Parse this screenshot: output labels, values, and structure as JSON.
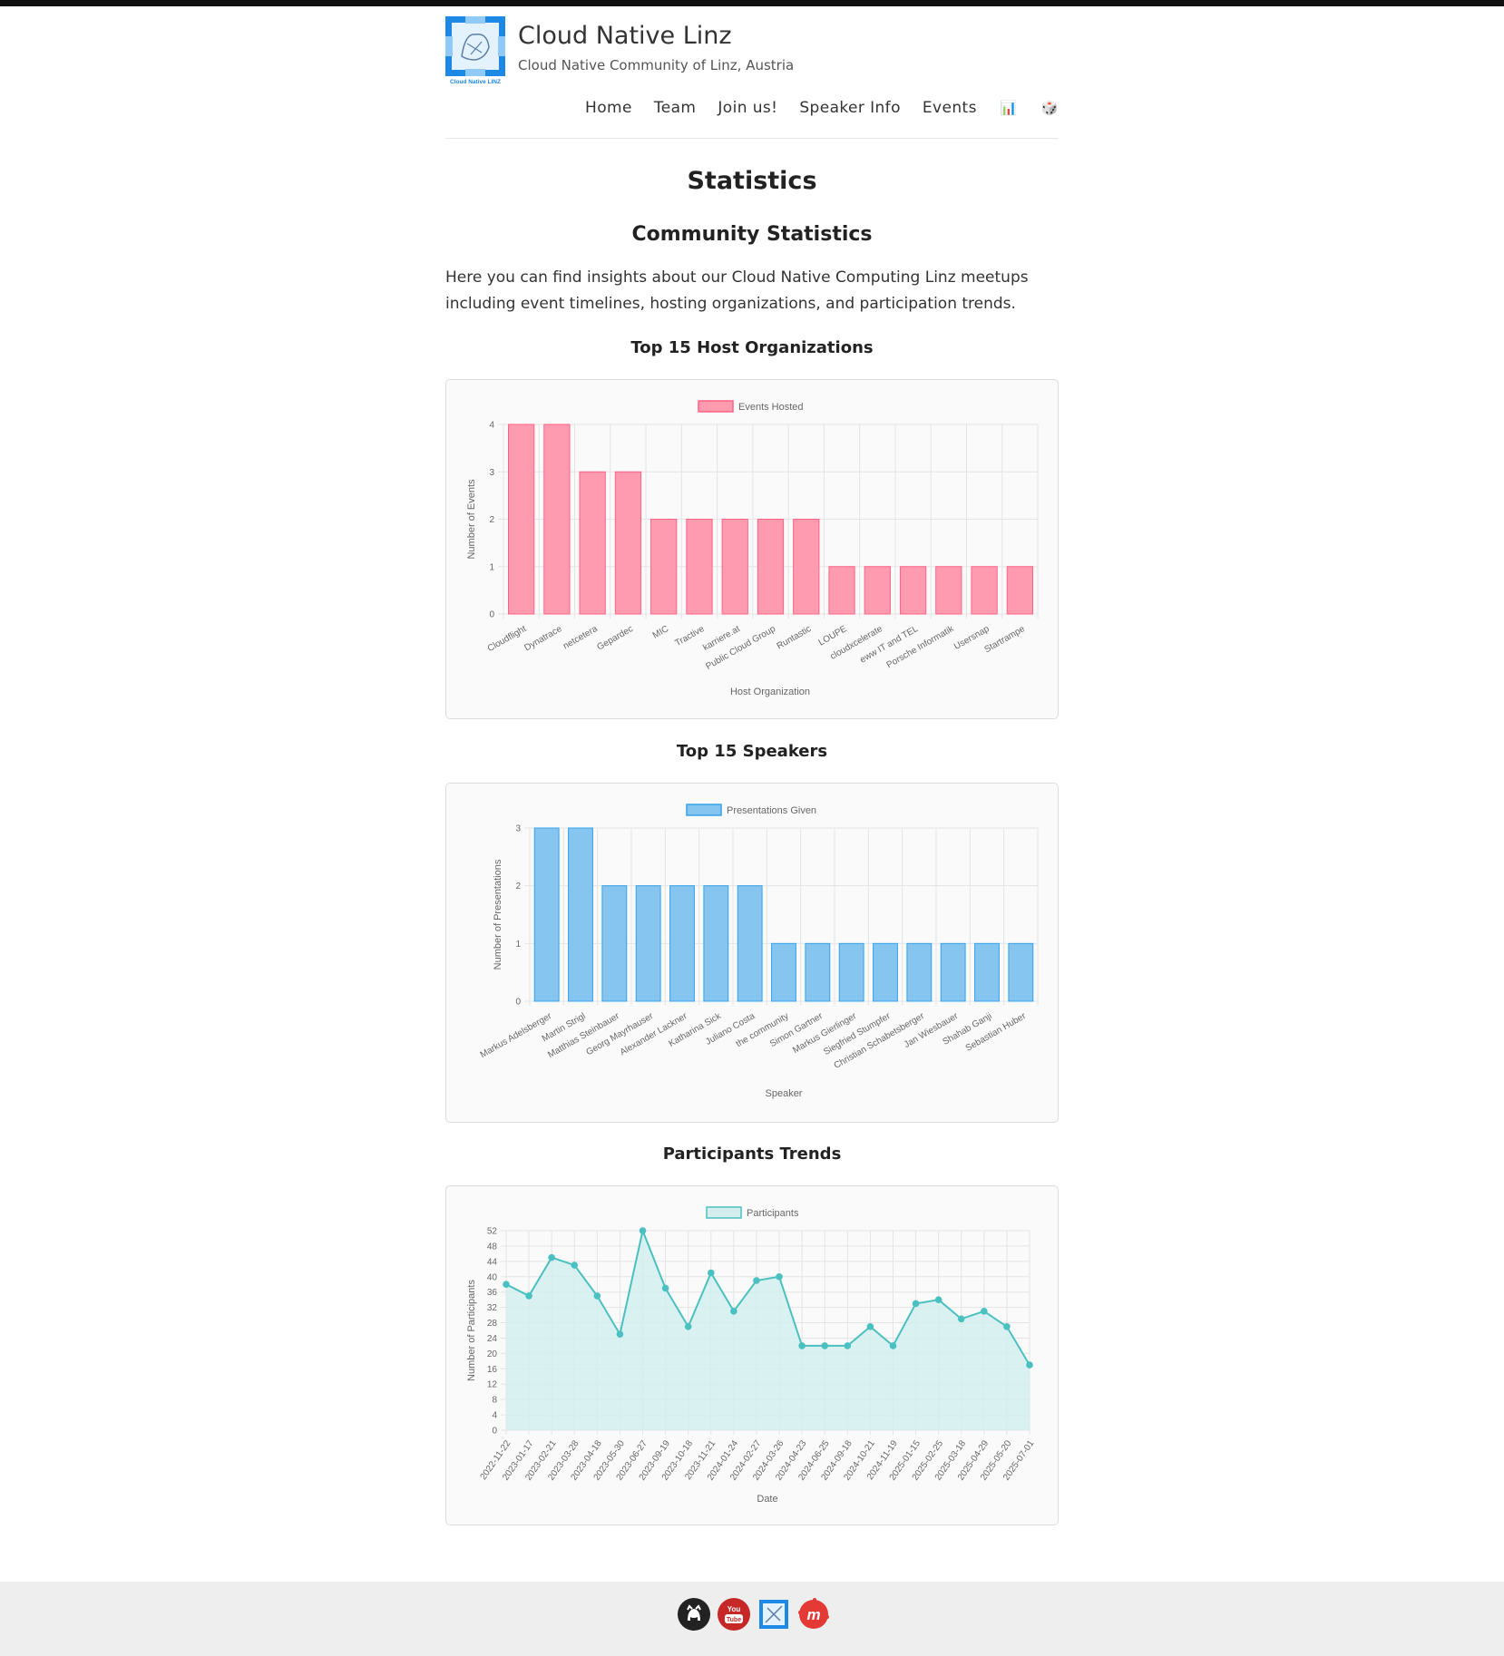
{
  "site": {
    "title": "Cloud Native Linz",
    "description": "Cloud Native Community of Linz, Austria",
    "logo_text": "Cloud Native LINZ"
  },
  "nav": {
    "items": [
      "Home",
      "Team",
      "Join us!",
      "Speaker Info",
      "Events"
    ],
    "emoji_stats": "📊",
    "emoji_dice": "🎲"
  },
  "page": {
    "title": "Statistics",
    "section_title": "Community Statistics",
    "intro": "Here you can find insights about our Cloud Native Computing Linz meetups including event timelines, hosting organizations, and participation trends."
  },
  "charts": {
    "hosts_title": "Top 15 Host Organizations",
    "speakers_title": "Top 15 Speakers",
    "participants_title": "Participants Trends"
  },
  "chart_data": [
    {
      "type": "bar",
      "title": "Top 15 Host Organizations",
      "categories": [
        "Cloudflight",
        "Dynatrace",
        "netcetera",
        "Gepardec",
        "MIC",
        "Tractive",
        "karriere.at",
        "Public Cloud Group",
        "Runtastic",
        "LOUPE",
        "cloudxcelerate",
        "eww IT and TEL",
        "Porsche Informatik",
        "Usersnap",
        "Startrampe"
      ],
      "series": [
        {
          "name": "Events Hosted",
          "values": [
            4,
            4,
            3,
            3,
            2,
            2,
            2,
            2,
            2,
            1,
            1,
            1,
            1,
            1,
            1
          ]
        }
      ],
      "xlabel": "Host Organization",
      "ylabel": "Number of Events",
      "ylim": [
        0,
        4
      ],
      "yticks": [
        0,
        1,
        2,
        3,
        4
      ],
      "grid": true,
      "legend": "top",
      "color": "#ff9bb0",
      "border_color": "#ff6384"
    },
    {
      "type": "bar",
      "title": "Top 15 Speakers",
      "categories": [
        "Markus Adelsberger",
        "Martin Strigl",
        "Matthias Steinbauer",
        "Georg Mayrhauser",
        "Alexander Lackner",
        "Katharina Sick",
        "Juliano Costa",
        "the community",
        "Simon Gartner",
        "Markus Gierlinger",
        "Siegfried Stumpfer",
        "Christian Schabetsberger",
        "Jan Wiesbauer",
        "Shahab Ganji",
        "Sebastian Huber"
      ],
      "series": [
        {
          "name": "Presentations Given",
          "values": [
            3,
            3,
            2,
            2,
            2,
            2,
            2,
            1,
            1,
            1,
            1,
            1,
            1,
            1,
            1
          ]
        }
      ],
      "xlabel": "Speaker",
      "ylabel": "Number of Presentations",
      "ylim": [
        0,
        3
      ],
      "yticks": [
        0,
        1,
        2,
        3
      ],
      "grid": true,
      "legend": "top",
      "color": "#86c5f0",
      "border_color": "#36a2eb"
    },
    {
      "type": "area",
      "title": "Participants Trends",
      "x": [
        "2022-11-22",
        "2023-01-17",
        "2023-02-21",
        "2023-03-28",
        "2023-04-18",
        "2023-05-30",
        "2023-06-27",
        "2023-09-19",
        "2023-10-18",
        "2023-11-21",
        "2024-01-24",
        "2024-02-27",
        "2024-03-26",
        "2024-04-23",
        "2024-06-25",
        "2024-09-18",
        "2024-10-21",
        "2024-11-19",
        "2025-01-15",
        "2025-02-25",
        "2025-03-18",
        "2025-04-29",
        "2025-05-20",
        "2025-07-01"
      ],
      "series": [
        {
          "name": "Participants",
          "values": [
            38,
            35,
            45,
            43,
            35,
            25,
            52,
            37,
            27,
            41,
            31,
            39,
            40,
            22,
            22,
            22,
            27,
            22,
            33,
            34,
            29,
            31,
            27,
            17
          ]
        }
      ],
      "xlabel": "Date",
      "ylabel": "Number of Participants",
      "ylim": [
        0,
        52
      ],
      "yticks": [
        0,
        4,
        8,
        12,
        16,
        20,
        24,
        28,
        32,
        36,
        40,
        44,
        48,
        52
      ],
      "grid": true,
      "legend": "top",
      "color": "#4bc0c0",
      "fill_color": "#d4eeee"
    }
  ],
  "footer": {
    "icons": [
      "github-icon",
      "youtube-icon",
      "cloud-native-linz-icon",
      "meetup-icon"
    ],
    "youtube_text": "You Tube",
    "meetup_text": "m"
  }
}
